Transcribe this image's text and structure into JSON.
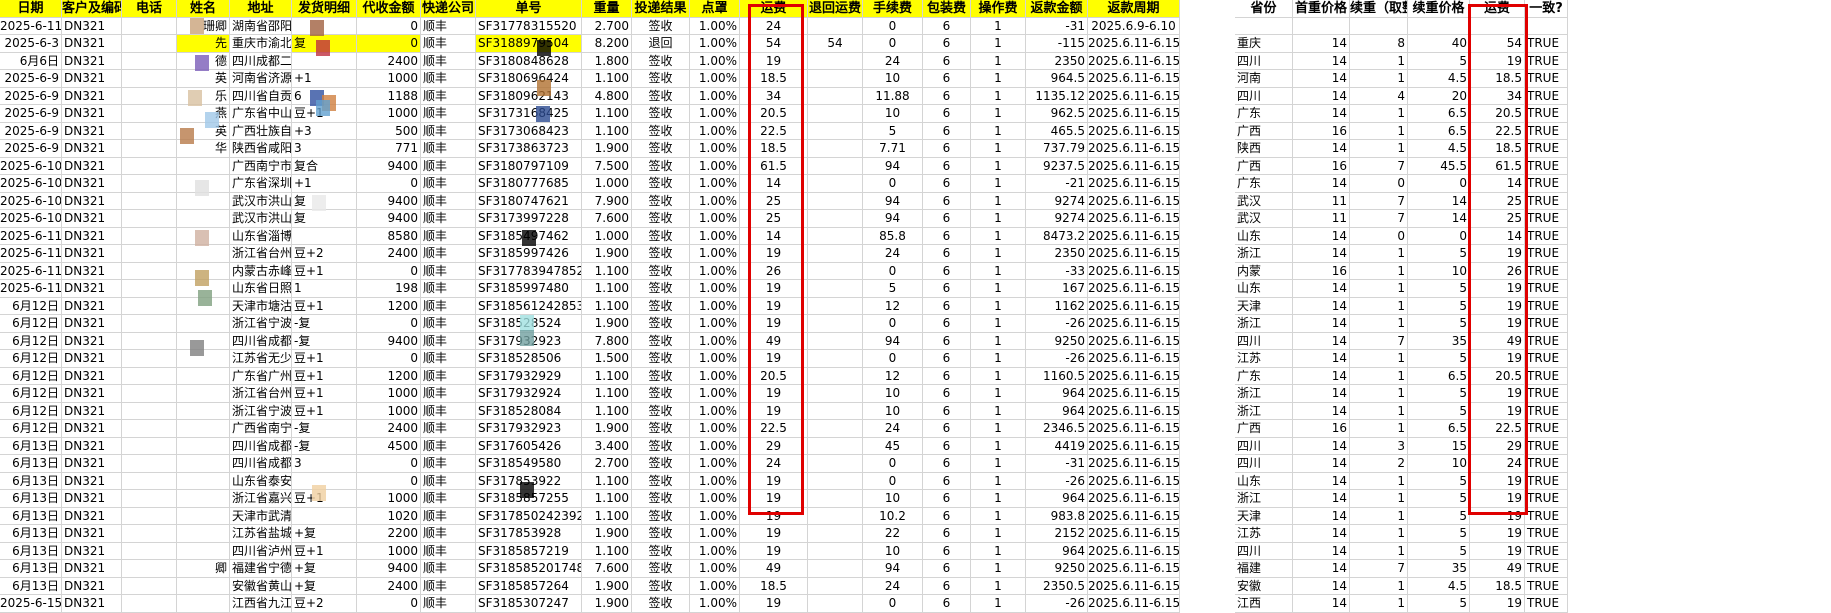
{
  "colors": {
    "highlight": "#ffff00",
    "box": "#e00000",
    "grid": "#d4d4d4"
  },
  "headers": {
    "left": [
      "日期",
      "客户及编码",
      "电话",
      "姓名",
      "地址",
      "发货明细",
      "代收金额",
      "快递公司",
      "单号",
      "重量",
      "投递结果",
      "点罩",
      "运费",
      "退回运费",
      "手续费",
      "包装费",
      "操作费",
      "返款金额",
      "返款周期"
    ],
    "right": [
      "省份",
      "首重价格",
      "续重（取整",
      "续重价格",
      "运费",
      "一致?"
    ]
  },
  "rows": [
    {
      "date": "2025-6-11",
      "code": "DN321",
      "name": "珊卿",
      "addr": "湖南省邵阳五色",
      "detail": "",
      "cod": "0",
      "courier": "顺丰",
      "tracking": "SF31778315520",
      "weight": "2.700",
      "result": "签收",
      "rate": "1.00%",
      "fee": "24",
      "ret": "",
      "handling": "0",
      "pack": "6",
      "op": "1",
      "refund": "-31",
      "period": "2025.6.9-6.10",
      "prov": "",
      "first": "",
      "cont": "",
      "contp": "",
      "fee2": "",
      "ok": ""
    },
    {
      "date": "2025-6-3",
      "code": "DN321",
      "name": "先",
      "addr": "重庆市渝北蓓春",
      "detail": "复",
      "cod": "0",
      "courier": "顺丰",
      "tracking": "SF3188979504",
      "weight": "8.200",
      "result": "退回",
      "rate": "1.00%",
      "fee": "54",
      "ret": "54",
      "handling": "0",
      "pack": "6",
      "op": "1",
      "refund": "-115",
      "period": "2025.6.11-6.15",
      "prov": "重庆",
      "first": "14",
      "cont": "8",
      "contp": "40",
      "fee2": "54",
      "ok": "TRUE"
    },
    {
      "date": "6月6日",
      "code": "DN321",
      "name": "德",
      "addr": "四川成都二复合",
      "detail": "",
      "cod": "2400",
      "courier": "顺丰",
      "tracking": "SF3180848628",
      "weight": "1.800",
      "result": "签收",
      "rate": "1.00%",
      "fee": "19",
      "ret": "",
      "handling": "24",
      "pack": "6",
      "op": "1",
      "refund": "2350",
      "period": "2025.6.11-6.15",
      "prov": "四川",
      "first": "14",
      "cont": "1",
      "contp": "5",
      "fee2": "19",
      "ok": "TRUE"
    },
    {
      "date": "2025-6-9",
      "code": "DN321",
      "name": "英",
      "addr": "河南省济源复合",
      "detail": "+1",
      "cod": "1000",
      "courier": "顺丰",
      "tracking": "SF3180696424",
      "weight": "1.100",
      "result": "签收",
      "rate": "1.00%",
      "fee": "18.5",
      "ret": "",
      "handling": "10",
      "pack": "6",
      "op": "1",
      "refund": "964.5",
      "period": "2025.6.11-6.15",
      "prov": "河南",
      "first": "14",
      "cont": "1",
      "contp": "4.5",
      "fee2": "18.5",
      "ok": "TRUE"
    },
    {
      "date": "2025-6-9",
      "code": "DN321",
      "name": "乐",
      "addr": "四川省自贡五白",
      "detail": "6",
      "cod": "1188",
      "courier": "顺丰",
      "tracking": "SF3180962143",
      "weight": "4.800",
      "result": "签收",
      "rate": "1.00%",
      "fee": "34",
      "ret": "",
      "handling": "11.88",
      "pack": "6",
      "op": "1",
      "refund": "1135.12",
      "period": "2025.6.11-6.15",
      "prov": "四川",
      "first": "14",
      "cont": "4",
      "contp": "20",
      "fee2": "34",
      "ok": "TRUE"
    },
    {
      "date": "2025-6-9",
      "code": "DN321",
      "name": "燕",
      "addr": "广东省中山复",
      "detail": "豆+1",
      "cod": "1000",
      "courier": "顺丰",
      "tracking": "SF3173168425",
      "weight": "1.100",
      "result": "签收",
      "rate": "1.00%",
      "fee": "20.5",
      "ret": "",
      "handling": "10",
      "pack": "6",
      "op": "1",
      "refund": "962.5",
      "period": "2025.6.11-6.15",
      "prov": "广东",
      "first": "14",
      "cont": "1",
      "contp": "6.5",
      "fee2": "20.5",
      "ok": "TRUE"
    },
    {
      "date": "2025-6-9",
      "code": "DN321",
      "name": "英",
      "addr": "广西壮族自五白",
      "detail": "+3",
      "cod": "500",
      "courier": "顺丰",
      "tracking": "SF3173068423",
      "weight": "1.100",
      "result": "签收",
      "rate": "1.00%",
      "fee": "22.5",
      "ret": "",
      "handling": "5",
      "pack": "6",
      "op": "1",
      "refund": "465.5",
      "period": "2025.6.11-6.15",
      "prov": "广西",
      "first": "16",
      "cont": "1",
      "contp": "6.5",
      "fee2": "22.5",
      "ok": "TRUE"
    },
    {
      "date": "2025-6-9",
      "code": "DN321",
      "name": "华",
      "addr": "陕西省咸阳五白",
      "detail": "3",
      "cod": "771",
      "courier": "顺丰",
      "tracking": "SF3173863723",
      "weight": "1.900",
      "result": "签收",
      "rate": "1.00%",
      "fee": "18.5",
      "ret": "",
      "handling": "7.71",
      "pack": "6",
      "op": "1",
      "refund": "737.79",
      "period": "2025.6.11-6.15",
      "prov": "陕西",
      "first": "14",
      "cont": "1",
      "contp": "4.5",
      "fee2": "18.5",
      "ok": "TRUE"
    },
    {
      "date": "2025-6-10",
      "code": "DN321",
      "name": "",
      "addr": "广西南宁市蓓",
      "detail": "复合",
      "cod": "9400",
      "courier": "顺丰",
      "tracking": "SF3180797109",
      "weight": "7.500",
      "result": "签收",
      "rate": "1.00%",
      "fee": "61.5",
      "ret": "",
      "handling": "94",
      "pack": "6",
      "op": "1",
      "refund": "9237.5",
      "period": "2025.6.11-6.15",
      "prov": "广西",
      "first": "16",
      "cont": "7",
      "contp": "45.5",
      "fee2": "61.5",
      "ok": "TRUE"
    },
    {
      "date": "2025-6-10",
      "code": "DN321",
      "name": "",
      "addr": "广东省深圳特殊",
      "detail": "+1",
      "cod": "0",
      "courier": "顺丰",
      "tracking": "SF3180777685",
      "weight": "1.000",
      "result": "签收",
      "rate": "1.00%",
      "fee": "14",
      "ret": "",
      "handling": "0",
      "pack": "6",
      "op": "1",
      "refund": "-21",
      "period": "2025.6.11-6.15",
      "prov": "广东",
      "first": "14",
      "cont": "0",
      "contp": "0",
      "fee2": "14",
      "ok": "TRUE"
    },
    {
      "date": "2025-6-10",
      "code": "DN321",
      "name": "",
      "addr": "武汉市洪山蓓春",
      "detail": "复",
      "cod": "9400",
      "courier": "顺丰",
      "tracking": "SF3180747621",
      "weight": "7.900",
      "result": "签收",
      "rate": "1.00%",
      "fee": "25",
      "ret": "",
      "handling": "94",
      "pack": "6",
      "op": "1",
      "refund": "9274",
      "period": "2025.6.11-6.15",
      "prov": "武汉",
      "first": "11",
      "cont": "7",
      "contp": "14",
      "fee2": "25",
      "ok": "TRUE"
    },
    {
      "date": "2025-6-10",
      "code": "DN321",
      "name": "",
      "addr": "武汉市洪山蓓春",
      "detail": "复",
      "cod": "9400",
      "courier": "顺丰",
      "tracking": "SF3173997228",
      "weight": "7.600",
      "result": "签收",
      "rate": "1.00%",
      "fee": "25",
      "ret": "",
      "handling": "94",
      "pack": "6",
      "op": "1",
      "refund": "9274",
      "period": "2025.6.11-6.15",
      "prov": "武汉",
      "first": "11",
      "cont": "7",
      "contp": "14",
      "fee2": "25",
      "ok": "TRUE"
    },
    {
      "date": "2025-6-11",
      "code": "DN321",
      "name": "",
      "addr": "山东省淄博蓓春",
      "detail": "",
      "cod": "8580",
      "courier": "顺丰",
      "tracking": "SF3185497462",
      "weight": "1.000",
      "result": "签收",
      "rate": "1.00%",
      "fee": "14",
      "ret": "",
      "handling": "85.8",
      "pack": "6",
      "op": "1",
      "refund": "8473.2",
      "period": "2025.6.11-6.15",
      "prov": "山东",
      "first": "14",
      "cont": "0",
      "contp": "0",
      "fee2": "14",
      "ok": "TRUE"
    },
    {
      "date": "2025-6-11",
      "code": "DN321",
      "name": "",
      "addr": "浙江省台州复合",
      "detail": "豆+2",
      "cod": "2400",
      "courier": "顺丰",
      "tracking": "SF3185997426",
      "weight": "1.900",
      "result": "签收",
      "rate": "1.00%",
      "fee": "19",
      "ret": "",
      "handling": "24",
      "pack": "6",
      "op": "1",
      "refund": "2350",
      "period": "2025.6.11-6.15",
      "prov": "浙江",
      "first": "14",
      "cont": "1",
      "contp": "5",
      "fee2": "19",
      "ok": "TRUE"
    },
    {
      "date": "2025-6-11",
      "code": "DN321",
      "name": "",
      "addr": "内蒙古赤峰复合",
      "detail": "豆+1",
      "cod": "0",
      "courier": "顺丰",
      "tracking": "SF3177839478524",
      "weight": "1.100",
      "result": "签收",
      "rate": "1.00%",
      "fee": "26",
      "ret": "",
      "handling": "0",
      "pack": "6",
      "op": "1",
      "refund": "-33",
      "period": "2025.6.11-6.15",
      "prov": "内蒙",
      "first": "16",
      "cont": "1",
      "contp": "10",
      "fee2": "26",
      "ok": "TRUE"
    },
    {
      "date": "2025-6-11",
      "code": "DN321",
      "name": "",
      "addr": "山东省日照五白",
      "detail": "1",
      "cod": "198",
      "courier": "顺丰",
      "tracking": "SF3185997480",
      "weight": "1.100",
      "result": "签收",
      "rate": "1.00%",
      "fee": "19",
      "ret": "",
      "handling": "5",
      "pack": "6",
      "op": "1",
      "refund": "167",
      "period": "2025.6.11-6.15",
      "prov": "山东",
      "first": "14",
      "cont": "1",
      "contp": "5",
      "fee2": "19",
      "ok": "TRUE"
    },
    {
      "date": "6月12日",
      "code": "DN321",
      "name": "",
      "addr": "天津市塘沽复合",
      "detail": "豆+1",
      "cod": "1200",
      "courier": "顺丰",
      "tracking": "SF3185612428533",
      "weight": "1.100",
      "result": "签收",
      "rate": "1.00%",
      "fee": "19",
      "ret": "",
      "handling": "12",
      "pack": "6",
      "op": "1",
      "refund": "1162",
      "period": "2025.6.11-6.15",
      "prov": "天津",
      "first": "14",
      "cont": "1",
      "contp": "5",
      "fee2": "19",
      "ok": "TRUE"
    },
    {
      "date": "6月12日",
      "code": "DN321",
      "name": "",
      "addr": "浙江省宁波蓓春",
      "detail": "-复",
      "cod": "0",
      "courier": "顺丰",
      "tracking": "SF318528524",
      "weight": "1.900",
      "result": "签收",
      "rate": "1.00%",
      "fee": "19",
      "ret": "",
      "handling": "0",
      "pack": "6",
      "op": "1",
      "refund": "-26",
      "period": "2025.6.11-6.15",
      "prov": "浙江",
      "first": "14",
      "cont": "1",
      "contp": "5",
      "fee2": "19",
      "ok": "TRUE"
    },
    {
      "date": "6月12日",
      "code": "DN321",
      "name": "",
      "addr": "四川省成都蓓春",
      "detail": "-复",
      "cod": "9400",
      "courier": "顺丰",
      "tracking": "SF317932923",
      "weight": "7.800",
      "result": "签收",
      "rate": "1.00%",
      "fee": "49",
      "ret": "",
      "handling": "94",
      "pack": "6",
      "op": "1",
      "refund": "9250",
      "period": "2025.6.11-6.15",
      "prov": "四川",
      "first": "14",
      "cont": "7",
      "contp": "35",
      "fee2": "49",
      "ok": "TRUE"
    },
    {
      "date": "6月12日",
      "code": "DN321",
      "name": "",
      "addr": "江苏省无少复合",
      "detail": "豆+1",
      "cod": "0",
      "courier": "顺丰",
      "tracking": "SF318528506",
      "weight": "1.500",
      "result": "签收",
      "rate": "1.00%",
      "fee": "19",
      "ret": "",
      "handling": "0",
      "pack": "6",
      "op": "1",
      "refund": "-26",
      "period": "2025.6.11-6.15",
      "prov": "江苏",
      "first": "14",
      "cont": "1",
      "contp": "5",
      "fee2": "19",
      "ok": "TRUE"
    },
    {
      "date": "6月12日",
      "code": "DN321",
      "name": "",
      "addr": "广东省广州复合",
      "detail": "豆+1",
      "cod": "1200",
      "courier": "顺丰",
      "tracking": "SF317932929",
      "weight": "1.100",
      "result": "签收",
      "rate": "1.00%",
      "fee": "20.5",
      "ret": "",
      "handling": "12",
      "pack": "6",
      "op": "1",
      "refund": "1160.5",
      "period": "2025.6.11-6.15",
      "prov": "广东",
      "first": "14",
      "cont": "1",
      "contp": "6.5",
      "fee2": "20.5",
      "ok": "TRUE"
    },
    {
      "date": "6月12日",
      "code": "DN321",
      "name": "",
      "addr": "浙江省台州复旦",
      "detail": "豆+1",
      "cod": "1000",
      "courier": "顺丰",
      "tracking": "SF317932924",
      "weight": "1.100",
      "result": "签收",
      "rate": "1.00%",
      "fee": "19",
      "ret": "",
      "handling": "10",
      "pack": "6",
      "op": "1",
      "refund": "964",
      "period": "2025.6.11-6.15",
      "prov": "浙江",
      "first": "14",
      "cont": "1",
      "contp": "5",
      "fee2": "19",
      "ok": "TRUE"
    },
    {
      "date": "6月12日",
      "code": "DN321",
      "name": "",
      "addr": "浙江省宁波复合",
      "detail": "豆+1",
      "cod": "1000",
      "courier": "顺丰",
      "tracking": "SF318528084",
      "weight": "1.100",
      "result": "签收",
      "rate": "1.00%",
      "fee": "19",
      "ret": "",
      "handling": "10",
      "pack": "6",
      "op": "1",
      "refund": "964",
      "period": "2025.6.11-6.15",
      "prov": "浙江",
      "first": "14",
      "cont": "1",
      "contp": "5",
      "fee2": "19",
      "ok": "TRUE"
    },
    {
      "date": "6月12日",
      "code": "DN321",
      "name": "",
      "addr": "广西省南宁蓓春",
      "detail": "-复",
      "cod": "2400",
      "courier": "顺丰",
      "tracking": "SF317932923",
      "weight": "1.900",
      "result": "签收",
      "rate": "1.00%",
      "fee": "22.5",
      "ret": "",
      "handling": "24",
      "pack": "6",
      "op": "1",
      "refund": "2346.5",
      "period": "2025.6.11-6.15",
      "prov": "广西",
      "first": "16",
      "cont": "1",
      "contp": "6.5",
      "fee2": "22.5",
      "ok": "TRUE"
    },
    {
      "date": "6月13日",
      "code": "DN321",
      "name": "",
      "addr": "四川省成都蓓春",
      "detail": "-复",
      "cod": "4500",
      "courier": "顺丰",
      "tracking": "SF317605426",
      "weight": "3.400",
      "result": "签收",
      "rate": "1.00%",
      "fee": "29",
      "ret": "",
      "handling": "45",
      "pack": "6",
      "op": "1",
      "refund": "4419",
      "period": "2025.6.11-6.15",
      "prov": "四川",
      "first": "14",
      "cont": "3",
      "contp": "15",
      "fee2": "29",
      "ok": "TRUE"
    },
    {
      "date": "6月13日",
      "code": "DN321",
      "name": "",
      "addr": "四川省成都蓓春",
      "detail": "3",
      "cod": "0",
      "courier": "顺丰",
      "tracking": "SF318549580",
      "weight": "2.700",
      "result": "签收",
      "rate": "1.00%",
      "fee": "24",
      "ret": "",
      "handling": "0",
      "pack": "6",
      "op": "1",
      "refund": "-31",
      "period": "2025.6.11-6.15",
      "prov": "四川",
      "first": "14",
      "cont": "2",
      "contp": "10",
      "fee2": "24",
      "ok": "TRUE"
    },
    {
      "date": "6月13日",
      "code": "DN321",
      "name": "",
      "addr": "山东省泰安蓓春",
      "detail": "",
      "cod": "0",
      "courier": "顺丰",
      "tracking": "SF317853922",
      "weight": "1.100",
      "result": "签收",
      "rate": "1.00%",
      "fee": "19",
      "ret": "",
      "handling": "0",
      "pack": "6",
      "op": "1",
      "refund": "-26",
      "period": "2025.6.11-6.15",
      "prov": "山东",
      "first": "14",
      "cont": "1",
      "contp": "5",
      "fee2": "19",
      "ok": "TRUE"
    },
    {
      "date": "6月13日",
      "code": "DN321",
      "name": "",
      "addr": "浙江省嘉兴复合",
      "detail": "豆+1",
      "cod": "1000",
      "courier": "顺丰",
      "tracking": "SF3185857255",
      "weight": "1.100",
      "result": "签收",
      "rate": "1.00%",
      "fee": "19",
      "ret": "",
      "handling": "10",
      "pack": "6",
      "op": "1",
      "refund": "964",
      "period": "2025.6.11-6.15",
      "prov": "浙江",
      "first": "14",
      "cont": "1",
      "contp": "5",
      "fee2": "19",
      "ok": "TRUE"
    },
    {
      "date": "6月13日",
      "code": "DN321",
      "name": "",
      "addr": "天津市武清蓓春",
      "detail": "",
      "cod": "1020",
      "courier": "顺丰",
      "tracking": "SF3178502423924",
      "weight": "1.100",
      "result": "签收",
      "rate": "1.00%",
      "fee": "19",
      "ret": "",
      "handling": "10.2",
      "pack": "6",
      "op": "1",
      "refund": "983.8",
      "period": "2025.6.11-6.15",
      "prov": "天津",
      "first": "14",
      "cont": "1",
      "contp": "5",
      "fee2": "19",
      "ok": "TRUE"
    },
    {
      "date": "6月13日",
      "code": "DN321",
      "name": "",
      "addr": "江苏省盐城蓓春",
      "detail": "+复",
      "cod": "2200",
      "courier": "顺丰",
      "tracking": "SF317853928",
      "weight": "1.900",
      "result": "签收",
      "rate": "1.00%",
      "fee": "19",
      "ret": "",
      "handling": "22",
      "pack": "6",
      "op": "1",
      "refund": "2152",
      "period": "2025.6.11-6.15",
      "prov": "江苏",
      "first": "14",
      "cont": "1",
      "contp": "5",
      "fee2": "19",
      "ok": "TRUE"
    },
    {
      "date": "6月13日",
      "code": "DN321",
      "name": "",
      "addr": "四川省泸州复合",
      "detail": "豆+1",
      "cod": "1000",
      "courier": "顺丰",
      "tracking": "SF3185857219",
      "weight": "1.100",
      "result": "签收",
      "rate": "1.00%",
      "fee": "19",
      "ret": "",
      "handling": "10",
      "pack": "6",
      "op": "1",
      "refund": "964",
      "period": "2025.6.11-6.15",
      "prov": "四川",
      "first": "14",
      "cont": "1",
      "contp": "5",
      "fee2": "19",
      "ok": "TRUE"
    },
    {
      "date": "6月13日",
      "code": "DN321",
      "name": "卿",
      "addr": "福建省宁德蓓春",
      "detail": "+复",
      "cod": "9400",
      "courier": "顺丰",
      "tracking": "SF3185852017485",
      "weight": "7.600",
      "result": "签收",
      "rate": "1.00%",
      "fee": "49",
      "ret": "",
      "handling": "94",
      "pack": "6",
      "op": "1",
      "refund": "9250",
      "period": "2025.6.11-6.15",
      "prov": "福建",
      "first": "14",
      "cont": "7",
      "contp": "35",
      "fee2": "49",
      "ok": "TRUE"
    },
    {
      "date": "6月13日",
      "code": "DN321",
      "name": "",
      "addr": "安徽省黄山蓓春",
      "detail": "+复",
      "cod": "2400",
      "courier": "顺丰",
      "tracking": "SF3185857264",
      "weight": "1.900",
      "result": "签收",
      "rate": "1.00%",
      "fee": "18.5",
      "ret": "",
      "handling": "24",
      "pack": "6",
      "op": "1",
      "refund": "2350.5",
      "period": "2025.6.11-6.15",
      "prov": "安徽",
      "first": "14",
      "cont": "1",
      "contp": "4.5",
      "fee2": "18.5",
      "ok": "TRUE"
    },
    {
      "date": "2025-6-15",
      "code": "DN321",
      "name": "",
      "addr": "江西省九江复合",
      "detail": "豆+2",
      "cod": "0",
      "courier": "顺丰",
      "tracking": "SF3185307247",
      "weight": "1.900",
      "result": "签收",
      "rate": "1.00%",
      "fee": "19",
      "ret": "",
      "handling": "0",
      "pack": "6",
      "op": "1",
      "refund": "-26",
      "period": "2025.6.11-6.15",
      "prov": "江西",
      "first": "14",
      "cont": "1",
      "contp": "5",
      "fee2": "19",
      "ok": "TRUE"
    }
  ]
}
